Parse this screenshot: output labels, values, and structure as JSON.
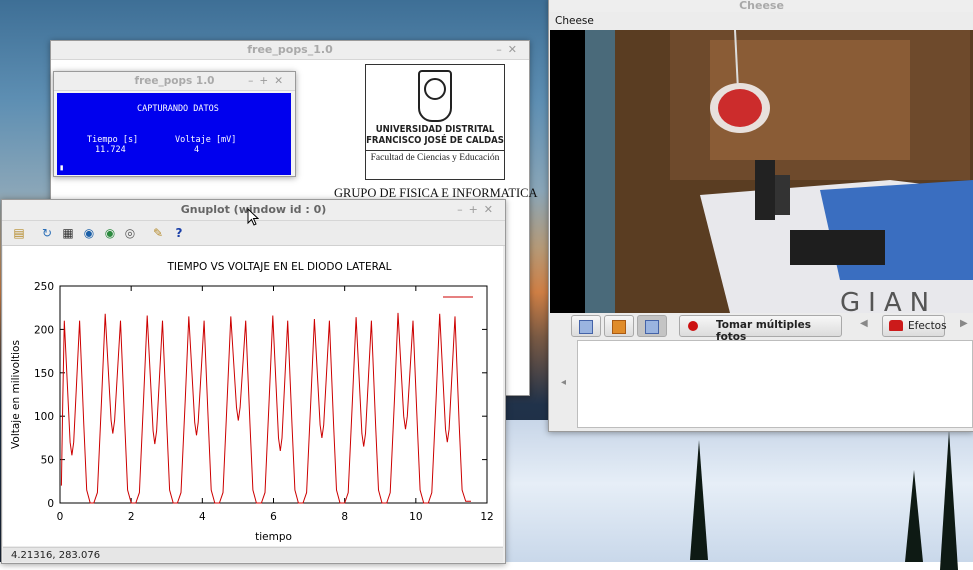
{
  "free_pops_main": {
    "title": "free_pops_1.0",
    "logo": {
      "university_line1": "UNIVERSIDAD DISTRITAL",
      "university_line2": "FRANCISCO JOSÉ DE CALDAS",
      "faculty": "Facultad de Ciencias y Educación"
    },
    "group_title": "GRUPO DE FISICA E INFORMATICA"
  },
  "free_pops_small": {
    "title": "free_pops 1.0",
    "status": "CAPTURANDO DATOS",
    "time_label": "Tiempo [s]",
    "time_value": "11.724",
    "voltage_label": "Voltaje [mV]",
    "voltage_value": "4",
    "cursor": "▮"
  },
  "gnuplot": {
    "title": "Gnuplot (window id : 0)",
    "status_coords": "4.21316,  283.076",
    "toolbar_icons": [
      "copy-clipboard-icon",
      "replot-icon",
      "grid-icon",
      "zoom-previous-icon",
      "zoom-next-icon",
      "unzoom-icon",
      "settings-icon",
      "help-icon"
    ]
  },
  "chart_data": {
    "type": "line",
    "title": "TIEMPO VS VOLTAJE EN EL DIODO LATERAL",
    "xlabel": "tiempo",
    "ylabel": "Voltaje en milivoltios",
    "xlim": [
      0,
      12
    ],
    "ylim": [
      0,
      250
    ],
    "xticks": [
      "0",
      "2",
      "4",
      "6",
      "8",
      "10",
      "12"
    ],
    "yticks": [
      "0",
      "50",
      "100",
      "150",
      "200",
      "250"
    ],
    "legend": "top-right",
    "series": [
      {
        "color": "#cc0000",
        "peaks_time": [
          0.12,
          0.55,
          1.27,
          1.7,
          2.45,
          2.88,
          3.62,
          4.05,
          4.8,
          5.22,
          5.98,
          6.4,
          7.15,
          7.57,
          8.32,
          8.75,
          9.5,
          9.92,
          10.67,
          11.1
        ],
        "peaks_value": [
          210,
          210,
          218,
          210,
          216,
          210,
          215,
          210,
          215,
          210,
          216,
          210,
          212,
          210,
          214,
          210,
          219,
          210,
          218,
          215
        ],
        "valleys_value": [
          55,
          80,
          68,
          78,
          95,
          60,
          75,
          65,
          85,
          70
        ]
      }
    ]
  },
  "cheese": {
    "title": "Cheese",
    "menu_label": "Cheese",
    "burst_button": "Tomar múltiples fotos",
    "effects_button": "Efectos",
    "prev_arrow": "◀",
    "next_arrow": "▶",
    "scroll_left": "◂"
  },
  "colors": {
    "terminal_bg": "#0000ee",
    "plot_line": "#cc0000",
    "window_bg": "#ececec"
  }
}
